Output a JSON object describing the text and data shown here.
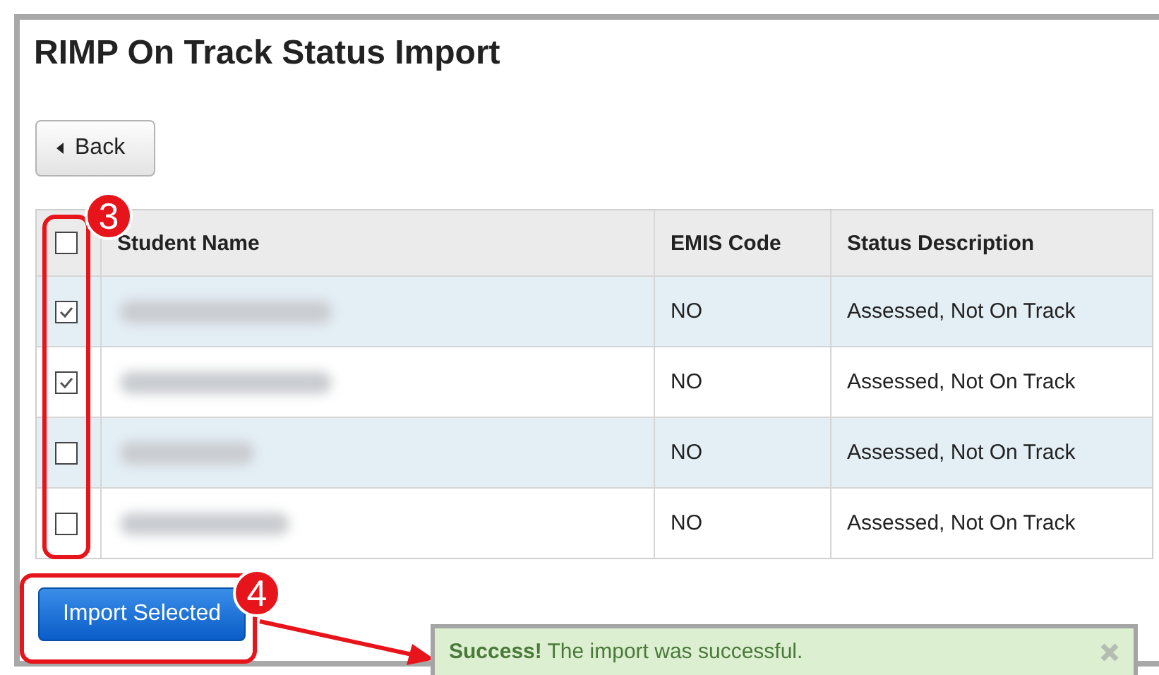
{
  "page": {
    "title": "RIMP On Track Status Import"
  },
  "back_button": {
    "label": "Back"
  },
  "table": {
    "select_all": {
      "checked": false
    },
    "columns": [
      "Student Name",
      "EMIS Code",
      "Status Description"
    ],
    "rows": [
      {
        "checked": true,
        "emis_code": "NO",
        "status": "Assessed, Not On Track"
      },
      {
        "checked": true,
        "emis_code": "NO",
        "status": "Assessed, Not On Track"
      },
      {
        "checked": false,
        "emis_code": "NO",
        "status": "Assessed, Not On Track"
      },
      {
        "checked": false,
        "emis_code": "NO",
        "status": "Assessed, Not On Track"
      }
    ]
  },
  "import_button": {
    "label": "Import Selected"
  },
  "annotations": [
    {
      "number": "3"
    },
    {
      "number": "4"
    }
  ],
  "toast": {
    "message": "**Success!** The import was successful."
  }
}
